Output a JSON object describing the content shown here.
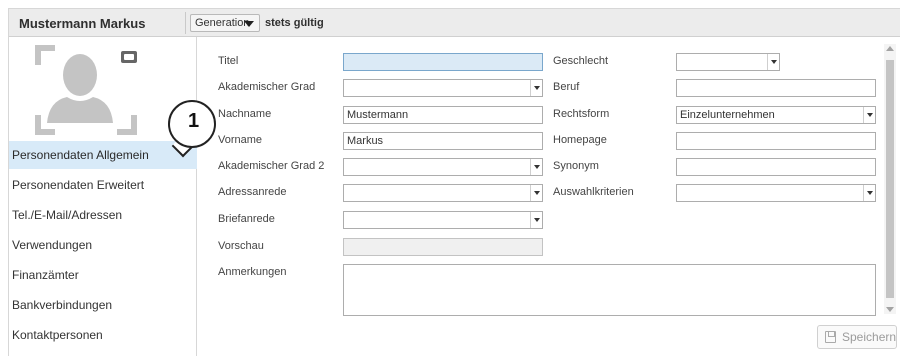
{
  "header": {
    "person_name": "Mustermann Markus",
    "generation_label": "Generation",
    "validity": "stets gültig"
  },
  "sidebar": {
    "avatar_icon": "person-placeholder-icon",
    "image_icon": "image-icon",
    "items": [
      {
        "label": "Personendaten Allgemein",
        "active": true
      },
      {
        "label": "Personendaten Erweitert",
        "active": false
      },
      {
        "label": "Tel./E-Mail/Adressen",
        "active": false
      },
      {
        "label": "Verwendungen",
        "active": false
      },
      {
        "label": "Finanzämter",
        "active": false
      },
      {
        "label": "Bankverbindungen",
        "active": false
      },
      {
        "label": "Kontaktpersonen",
        "active": false
      }
    ]
  },
  "callout": {
    "number": "1"
  },
  "form": {
    "left": {
      "titel": {
        "label": "Titel",
        "value": ""
      },
      "akad_grad": {
        "label": "Akademischer Grad",
        "value": ""
      },
      "nachname": {
        "label": "Nachname",
        "value": "Mustermann"
      },
      "vorname": {
        "label": "Vorname",
        "value": "Markus"
      },
      "akad_grad2": {
        "label": "Akademischer Grad 2",
        "value": ""
      },
      "adressanrede": {
        "label": "Adressanrede",
        "value": ""
      },
      "briefanrede": {
        "label": "Briefanrede",
        "value": ""
      },
      "vorschau": {
        "label": "Vorschau",
        "value": ""
      },
      "anmerkungen": {
        "label": "Anmerkungen",
        "value": ""
      }
    },
    "right": {
      "geschlecht": {
        "label": "Geschlecht",
        "value": ""
      },
      "beruf": {
        "label": "Beruf",
        "value": ""
      },
      "rechtsform": {
        "label": "Rechtsform",
        "value": "Einzelunternehmen"
      },
      "homepage": {
        "label": "Homepage",
        "value": ""
      },
      "synonym": {
        "label": "Synonym",
        "value": ""
      },
      "auswahlkriterien": {
        "label": "Auswahlkriterien",
        "value": ""
      }
    }
  },
  "actions": {
    "save_label": "Speichern"
  },
  "colors": {
    "active_nav": "#d8eaf8",
    "focus_field": "#dbeaf6",
    "header_bg": "#ececec"
  }
}
